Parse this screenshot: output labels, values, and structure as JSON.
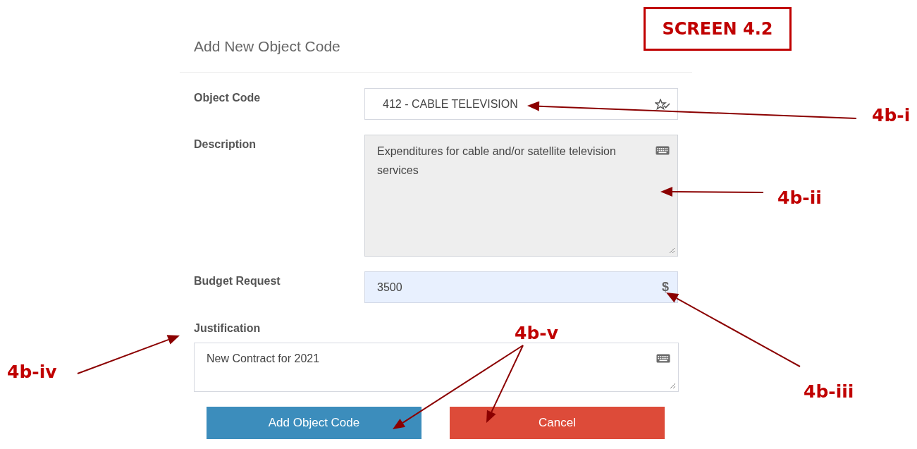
{
  "screen_label": "SCREEN 4.2",
  "form": {
    "title": "Add New Object Code",
    "fields": [
      {
        "kind": "select",
        "label": "Object Code",
        "value": "412 - CABLE TELEVISION"
      },
      {
        "kind": "readonly_text",
        "label": "Description",
        "value": "Expenditures for cable and/or satellite television services"
      },
      {
        "kind": "currency",
        "label": "Budget Request",
        "value": "3500",
        "symbol": "$"
      },
      {
        "kind": "text",
        "label": "Justification",
        "value": "New Contract for 2021"
      }
    ],
    "buttons": [
      {
        "label": "Add Object Code",
        "kind": "primary"
      },
      {
        "label": "Cancel",
        "kind": "danger"
      }
    ]
  },
  "annotations": [
    {
      "label": "4b-i"
    },
    {
      "label": "4b-ii"
    },
    {
      "label": "4b-iii"
    },
    {
      "label": "4b-iv"
    },
    {
      "label": "4b-v"
    }
  ]
}
